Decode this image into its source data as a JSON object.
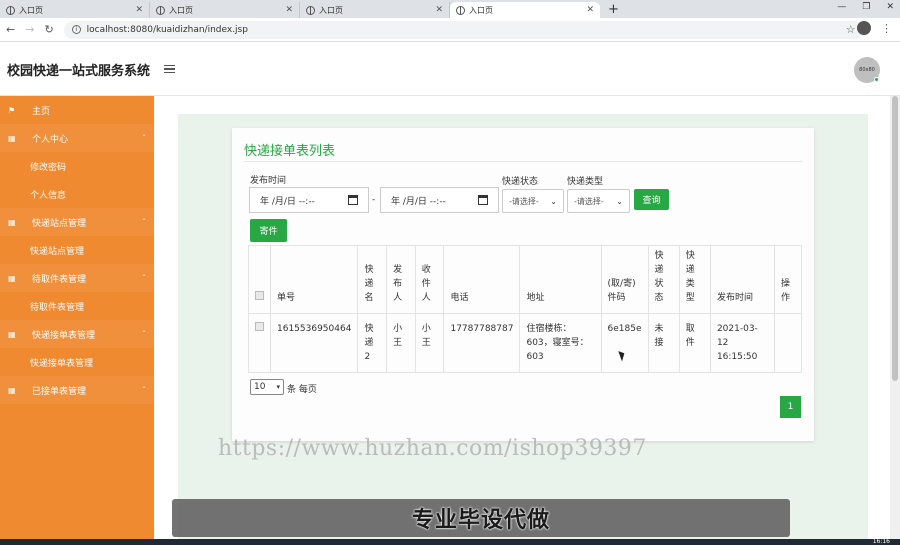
{
  "browser": {
    "tabs": [
      {
        "title": "入口页",
        "active": false
      },
      {
        "title": "入口页",
        "active": false
      },
      {
        "title": "入口页",
        "active": false
      },
      {
        "title": "入口页",
        "active": true
      }
    ],
    "url": "localhost:8080/kuaidizhan/index.jsp"
  },
  "header": {
    "brand": "校园快递一站式服务系统",
    "avatar_text": "80x80"
  },
  "sidebar": {
    "items": [
      {
        "label": "主页",
        "type": "top",
        "icon": "flag-icon"
      },
      {
        "label": "个人中心",
        "type": "group",
        "icon": "grid-icon"
      },
      {
        "label": "修改密码",
        "type": "sub"
      },
      {
        "label": "个人信息",
        "type": "sub"
      },
      {
        "label": "快递站点管理",
        "type": "group",
        "icon": "grid-icon"
      },
      {
        "label": "快递站点管理",
        "type": "sub"
      },
      {
        "label": "待取件表管理",
        "type": "group",
        "icon": "grid-icon"
      },
      {
        "label": "待取件表管理",
        "type": "sub"
      },
      {
        "label": "快递接单表管理",
        "type": "group",
        "icon": "grid-icon"
      },
      {
        "label": "快递接单表管理",
        "type": "sub"
      },
      {
        "label": "已接单表管理",
        "type": "group",
        "icon": "grid-icon"
      }
    ]
  },
  "card": {
    "title": "快递接单表列表",
    "filters": {
      "publish_time_label": "发布时间",
      "date_placeholder_start": "年 /月/日 --:--",
      "date_placeholder_end": "年 /月/日 --:--",
      "date_separator": "-",
      "status_label": "快递状态",
      "status_value": "-请选择-",
      "type_label": "快递类型",
      "type_value": "-请选择-",
      "query_button": "查询",
      "send_button": "寄件"
    },
    "table": {
      "headers": [
        "单号",
        "快递名",
        "发布人",
        "收件人",
        "电话",
        "地址",
        "(取/寄)件码",
        "快递状态",
        "快递类型",
        "发布时间",
        "操作"
      ],
      "rows": [
        {
          "order_no": "1615536950464",
          "courier": "快递2",
          "publisher": "小王",
          "receiver": "小王",
          "phone": "17787788787",
          "address": "住宿楼栋：603，寝室号：603",
          "code": "6e185e",
          "status": "未接",
          "type": "取件",
          "publish_time": "2021-03-12 16:15:50",
          "actions": ""
        }
      ]
    },
    "pager": {
      "page_size": "10",
      "per_page_label": "条 每页",
      "current_page": "1"
    }
  },
  "overlay": {
    "watermark": "https://www.huzhan.com/ishop39397",
    "banner": "专业毕设代做",
    "clock": "16:16"
  }
}
